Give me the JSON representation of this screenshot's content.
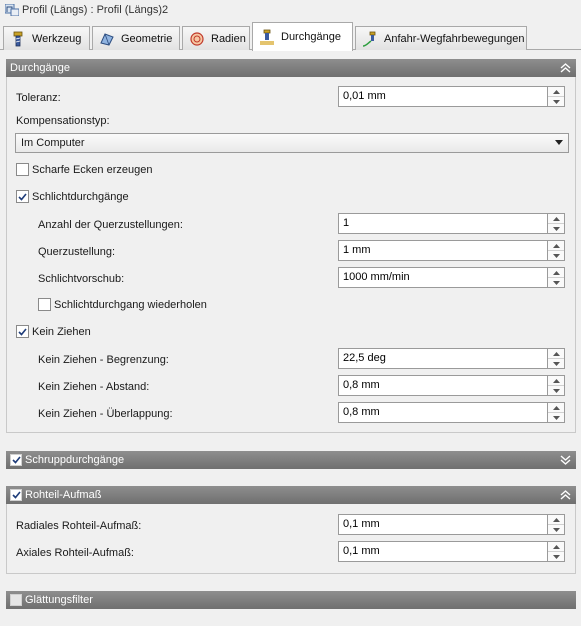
{
  "window": {
    "title": "Profil (Längs) : Profil (Längs)2"
  },
  "tabs": [
    {
      "label": "Werkzeug",
      "icon": "tool-icon"
    },
    {
      "label": "Geometrie",
      "icon": "geometry-icon"
    },
    {
      "label": "Radien",
      "icon": "radii-icon"
    },
    {
      "label": "Durchgänge",
      "icon": "passes-icon",
      "active": true
    },
    {
      "label": "Anfahr-Wegfahrbewegungen",
      "icon": "linking-icon"
    }
  ],
  "durchgaenge": {
    "header": "Durchgänge",
    "toleranz_label": "Toleranz:",
    "toleranz_value": "0,01 mm",
    "kompensation_label": "Kompensationstyp:",
    "kompensation_value": "Im Computer",
    "scharfe_ecken_label": "Scharfe Ecken erzeugen",
    "scharfe_ecken_checked": false,
    "schlicht_label": "Schlichtdurchgänge",
    "schlicht_checked": true,
    "anzahl_label": "Anzahl der Querzustellungen:",
    "anzahl_value": "1",
    "querzustellung_label": "Querzustellung:",
    "querzustellung_value": "1 mm",
    "vorschub_label": "Schlichtvorschub:",
    "vorschub_value": "1000 mm/min",
    "wiederholen_label": "Schlichtdurchgang wiederholen",
    "wiederholen_checked": false,
    "kein_ziehen_label": "Kein Ziehen",
    "kein_ziehen_checked": true,
    "begrenzung_label": "Kein Ziehen - Begrenzung:",
    "begrenzung_value": "22,5 deg",
    "abstand_label": "Kein Ziehen - Abstand:",
    "abstand_value": "0,8 mm",
    "ueberlappung_label": "Kein Ziehen - Überlappung:",
    "ueberlappung_value": "0,8 mm"
  },
  "schrupp": {
    "header": "Schruppdurchgänge",
    "checked": true
  },
  "rohteil": {
    "header": "Rohteil-Aufmaß",
    "checked": true,
    "radial_label": "Radiales Rohteil-Aufmaß:",
    "radial_value": "0,1 mm",
    "axial_label": "Axiales Rohteil-Aufmaß:",
    "axial_value": "0,1 mm"
  },
  "glaettung": {
    "header": "Glättungsfilter",
    "checked": false
  },
  "colors": {
    "header_bg": "#7f7f7f",
    "panel_bg": "#f0f0f0",
    "field_border": "#9a9a9a"
  }
}
